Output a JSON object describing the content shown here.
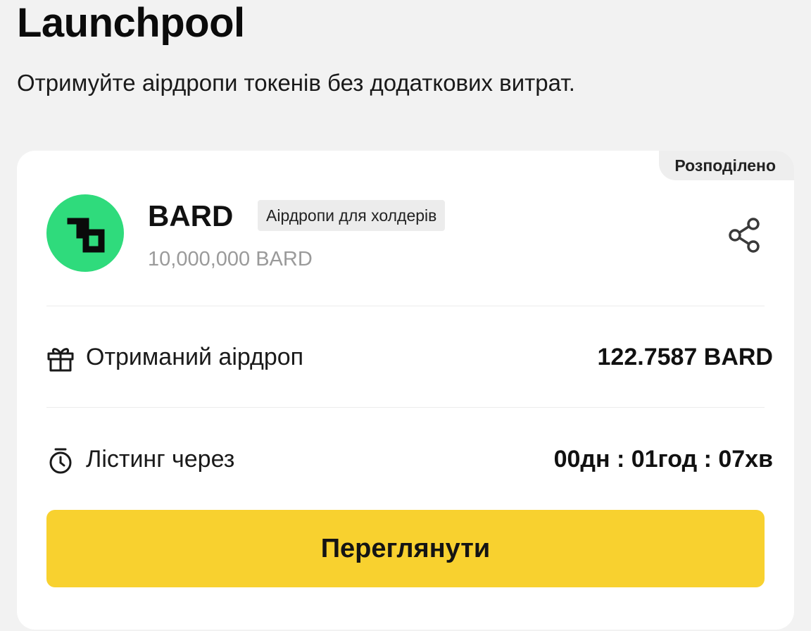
{
  "header": {
    "title": "Launchpool",
    "subtitle": "Отримуйте аірдропи токенів без додаткових витрат."
  },
  "card": {
    "status": "Розподілено",
    "token": {
      "name": "BARD",
      "tag": "Аірдропи для холдерів",
      "supply": "10,000,000 BARD",
      "logo_icon": "bard-logo-icon",
      "logo_color": "#2fdb7c"
    },
    "share_icon": "share-icon",
    "airdrop": {
      "icon": "gift-icon",
      "label": "Отриманий аірдроп",
      "value": "122.7587 BARD"
    },
    "listing": {
      "icon": "stopwatch-icon",
      "label": "Лістинг через",
      "value": "00дн : 01год : 07хв"
    },
    "button": {
      "label": "Переглянути",
      "color": "#f8d12f"
    }
  }
}
